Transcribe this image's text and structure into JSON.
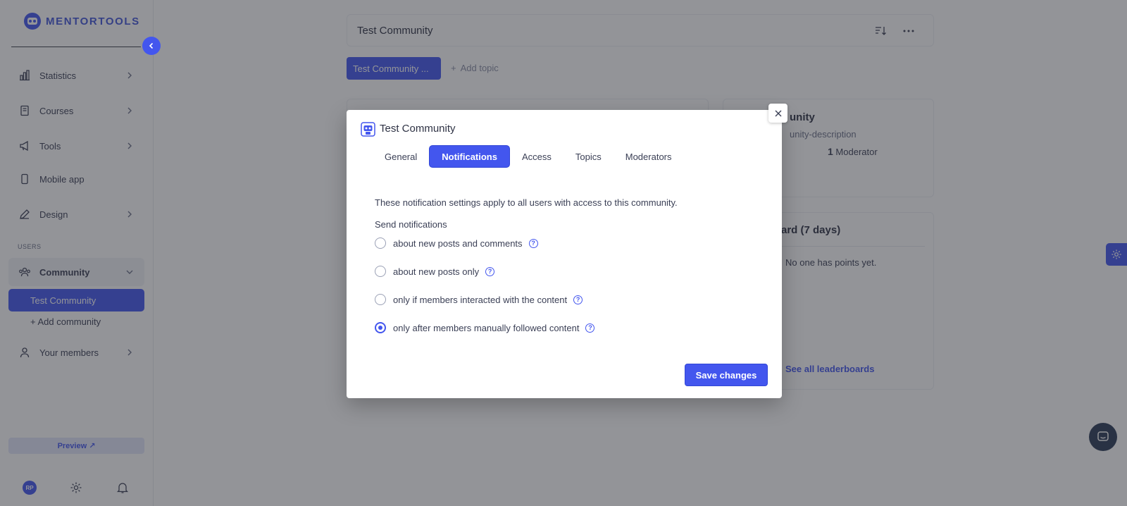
{
  "app": {
    "name": "MENTORTOOLS"
  },
  "sidebar": {
    "items": [
      {
        "label": "Statistics"
      },
      {
        "label": "Courses"
      },
      {
        "label": "Tools"
      },
      {
        "label": "Mobile app"
      },
      {
        "label": "Design"
      }
    ],
    "section_users": "USERS",
    "community": {
      "label": "Community",
      "active_sub": "Test Community",
      "add": "+ Add community"
    },
    "members": {
      "label": "Your members"
    },
    "preview": "Preview ↗",
    "avatar_initials": "RP"
  },
  "main": {
    "header_title": "Test Community",
    "topic_chip": "Test Community ...",
    "add_topic": "Add topic",
    "info_card": {
      "title": "unity",
      "description": "unity-description",
      "moderators_count": "1",
      "moderators_label": "Moderator"
    },
    "leaderboard": {
      "title": "ard (7 days)",
      "empty": "No one has points yet.",
      "link": "See all leaderboards"
    }
  },
  "modal": {
    "title": "Test Community",
    "tabs": [
      {
        "label": "General"
      },
      {
        "label": "Notifications"
      },
      {
        "label": "Access"
      },
      {
        "label": "Topics"
      },
      {
        "label": "Moderators"
      }
    ],
    "intro": "These notification settings apply to all users with access to this community.",
    "send_label": "Send notifications",
    "options": [
      {
        "label": "about new posts and comments"
      },
      {
        "label": "about new posts only"
      },
      {
        "label": "only if members interacted with the content"
      },
      {
        "label": "only after members manually followed content"
      }
    ],
    "help_glyph": "?",
    "save": "Save changes"
  },
  "colors": {
    "accent": "#4356ee",
    "overlay": "#282a32"
  }
}
